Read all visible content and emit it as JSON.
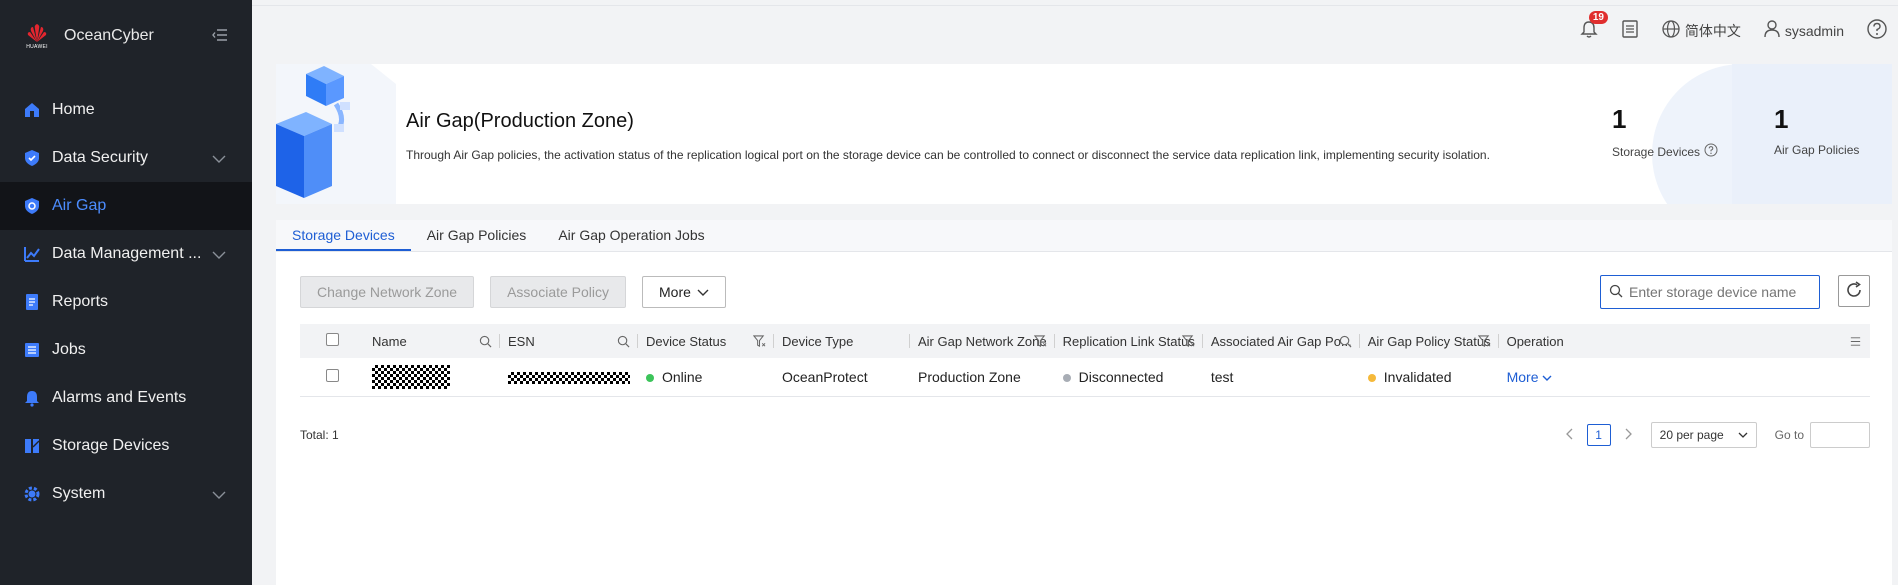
{
  "app": {
    "name": "OceanCyber",
    "logo_text": "HUAWEI"
  },
  "sidebar": {
    "items": [
      {
        "label": "Home",
        "icon": "home-icon"
      },
      {
        "label": "Data Security",
        "icon": "shield-icon",
        "expandable": true
      },
      {
        "label": "Air Gap",
        "icon": "airgap-shield-icon",
        "active": true
      },
      {
        "label": "Data Management ...",
        "icon": "chart-icon",
        "expandable": true
      },
      {
        "label": "Reports",
        "icon": "report-icon"
      },
      {
        "label": "Jobs",
        "icon": "jobs-icon"
      },
      {
        "label": "Alarms and Events",
        "icon": "bell-icon"
      },
      {
        "label": "Storage Devices",
        "icon": "storage-icon"
      },
      {
        "label": "System",
        "icon": "gear-icon",
        "expandable": true
      }
    ]
  },
  "topbar": {
    "notification_count": "19",
    "language": "简体中文",
    "user": "sysadmin"
  },
  "banner": {
    "title": "Air Gap(Production Zone)",
    "description": "Through Air Gap policies, the activation status of the replication logical port on the storage device can be controlled to connect or disconnect the service data replication link, implementing security isolation.",
    "stats": [
      {
        "value": "1",
        "label": "Storage Devices"
      },
      {
        "value": "1",
        "label": "Air Gap Policies"
      }
    ]
  },
  "tabs": [
    "Storage Devices",
    "Air Gap Policies",
    "Air Gap Operation Jobs"
  ],
  "toolbar": {
    "change_zone": "Change Network Zone",
    "associate_policy": "Associate Policy",
    "more": "More",
    "search_placeholder": "Enter storage device name"
  },
  "table": {
    "columns": [
      "Name",
      "ESN",
      "Device Status",
      "Device Type",
      "Air Gap Network Zone",
      "Replication Link Status",
      "Associated Air Gap Po...",
      "Air Gap Policy Status",
      "Operation"
    ],
    "rows": [
      {
        "device_status": "Online",
        "device_type": "OceanProtect",
        "network_zone": "Production Zone",
        "link_status": "Disconnected",
        "policy": "test",
        "policy_status": "Invalidated",
        "operation": "More"
      }
    ]
  },
  "footer": {
    "total": "Total: 1",
    "page": "1",
    "per_page": "20 per page",
    "goto": "Go to"
  },
  "colors": {
    "accent": "#1e5ed4",
    "online": "#3cc45a",
    "disconnected": "#a8adb5",
    "invalidated": "#f5b93a",
    "sidebar_bg": "#1f2329"
  }
}
